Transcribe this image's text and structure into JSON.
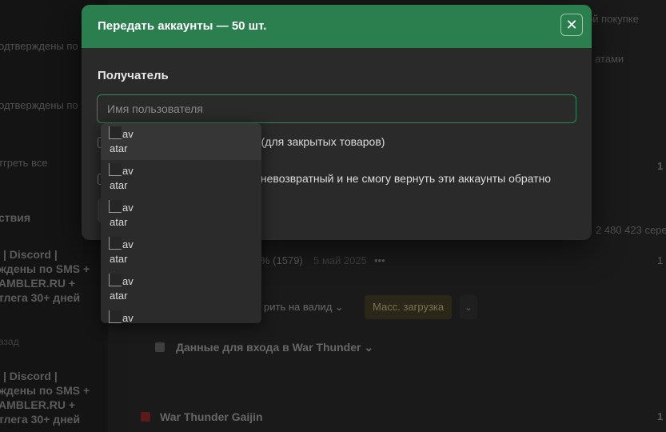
{
  "background": {
    "left_items": [
      "одтверждены по",
      "одтверждены по",
      "тгреть все",
      "ствия",
      "| Discord |",
      "ждены по SMS +",
      "AMBLER.RU +",
      "тлега 30+ дней",
      "азад",
      "| Discord |",
      "ждены по SMS +",
      "AMBLER.RU +",
      "тлега 30+ дней"
    ],
    "top_right": "ой покупке",
    "right_tab": "атами",
    "count_1": "1",
    "count_2": "1",
    "count_3": "1",
    "stat_text": "2 480 423 сере",
    "rating": "% (1579)",
    "date": "5 май 2025",
    "dots": "•••",
    "validate_label": "рить на валид",
    "bulk_upload_label": "Масс. загрузка",
    "login_data_label": "Данные для входа в War Thunder",
    "game_title": "War Thunder Gaijin"
  },
  "modal": {
    "title": "Передать аккаунты — 50 шт.",
    "close_symbol": "✕",
    "recipient_label": "Получатель",
    "recipient_placeholder": "Имя пользователя",
    "recipient_value": "",
    "option_1_text": "н (для закрытых товаров)",
    "option_2_text": "с невозвратный и не смогу вернуть эти аккаунты обратно"
  },
  "dropdown": {
    "items": [
      {
        "line1": "av",
        "line2": "atar"
      },
      {
        "line1": "av",
        "line2": "atar"
      },
      {
        "line1": "av",
        "line2": "atar"
      },
      {
        "line1": "av",
        "line2": "atar"
      },
      {
        "line1": "av",
        "line2": "atar"
      },
      {
        "line1": "av",
        "line2": ""
      }
    ]
  },
  "colors": {
    "header_green": "#2b7f4e",
    "input_border": "#2f8a55"
  }
}
